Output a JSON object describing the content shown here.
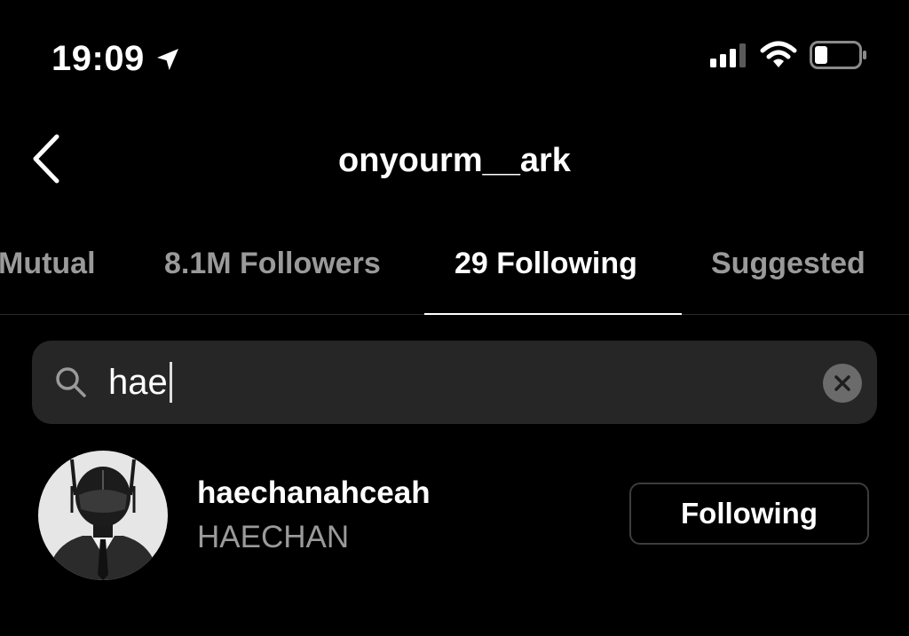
{
  "status_bar": {
    "time": "19:09",
    "icons": [
      "location-arrow-icon",
      "cellular-signal-icon",
      "wifi-icon",
      "battery-icon"
    ]
  },
  "header": {
    "back_icon": "chevron-left-icon",
    "title": "onyourm__ark"
  },
  "tabs": [
    {
      "label": "Mutual",
      "active": false
    },
    {
      "label": "8.1M Followers",
      "active": false
    },
    {
      "label": "29 Following",
      "active": true
    },
    {
      "label": "Suggested",
      "active": false
    }
  ],
  "search": {
    "icon": "search-icon",
    "value": "hae",
    "clear_icon": "clear-x-icon"
  },
  "results": [
    {
      "username": "haechanahceah",
      "full_name": "HAECHAN",
      "button_label": "Following"
    }
  ],
  "colors": {
    "background": "#000000",
    "search_bg": "#262626",
    "secondary_text": "#9a9a9a",
    "button_border": "#3c3c3c"
  }
}
